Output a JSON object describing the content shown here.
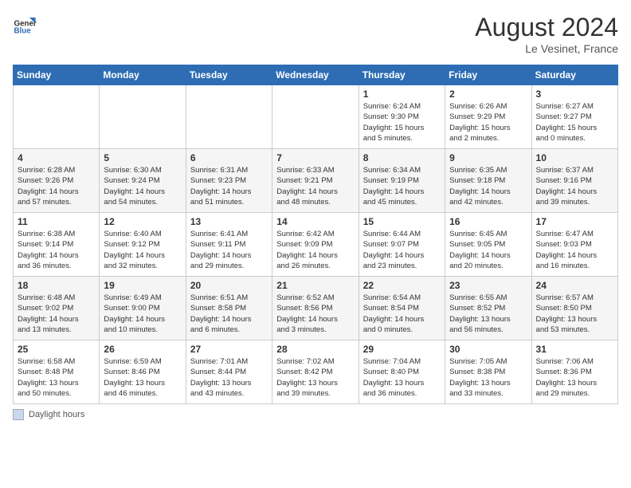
{
  "header": {
    "logo_line1": "General",
    "logo_line2": "Blue",
    "month": "August 2024",
    "location": "Le Vesinet, France"
  },
  "weekdays": [
    "Sunday",
    "Monday",
    "Tuesday",
    "Wednesday",
    "Thursday",
    "Friday",
    "Saturday"
  ],
  "legend": {
    "box_label": "Daylight hours"
  },
  "weeks": [
    [
      {
        "day": "",
        "info": ""
      },
      {
        "day": "",
        "info": ""
      },
      {
        "day": "",
        "info": ""
      },
      {
        "day": "",
        "info": ""
      },
      {
        "day": "1",
        "info": "Sunrise: 6:24 AM\nSunset: 9:30 PM\nDaylight: 15 hours\nand 5 minutes."
      },
      {
        "day": "2",
        "info": "Sunrise: 6:26 AM\nSunset: 9:29 PM\nDaylight: 15 hours\nand 2 minutes."
      },
      {
        "day": "3",
        "info": "Sunrise: 6:27 AM\nSunset: 9:27 PM\nDaylight: 15 hours\nand 0 minutes."
      }
    ],
    [
      {
        "day": "4",
        "info": "Sunrise: 6:28 AM\nSunset: 9:26 PM\nDaylight: 14 hours\nand 57 minutes."
      },
      {
        "day": "5",
        "info": "Sunrise: 6:30 AM\nSunset: 9:24 PM\nDaylight: 14 hours\nand 54 minutes."
      },
      {
        "day": "6",
        "info": "Sunrise: 6:31 AM\nSunset: 9:23 PM\nDaylight: 14 hours\nand 51 minutes."
      },
      {
        "day": "7",
        "info": "Sunrise: 6:33 AM\nSunset: 9:21 PM\nDaylight: 14 hours\nand 48 minutes."
      },
      {
        "day": "8",
        "info": "Sunrise: 6:34 AM\nSunset: 9:19 PM\nDaylight: 14 hours\nand 45 minutes."
      },
      {
        "day": "9",
        "info": "Sunrise: 6:35 AM\nSunset: 9:18 PM\nDaylight: 14 hours\nand 42 minutes."
      },
      {
        "day": "10",
        "info": "Sunrise: 6:37 AM\nSunset: 9:16 PM\nDaylight: 14 hours\nand 39 minutes."
      }
    ],
    [
      {
        "day": "11",
        "info": "Sunrise: 6:38 AM\nSunset: 9:14 PM\nDaylight: 14 hours\nand 36 minutes."
      },
      {
        "day": "12",
        "info": "Sunrise: 6:40 AM\nSunset: 9:12 PM\nDaylight: 14 hours\nand 32 minutes."
      },
      {
        "day": "13",
        "info": "Sunrise: 6:41 AM\nSunset: 9:11 PM\nDaylight: 14 hours\nand 29 minutes."
      },
      {
        "day": "14",
        "info": "Sunrise: 6:42 AM\nSunset: 9:09 PM\nDaylight: 14 hours\nand 26 minutes."
      },
      {
        "day": "15",
        "info": "Sunrise: 6:44 AM\nSunset: 9:07 PM\nDaylight: 14 hours\nand 23 minutes."
      },
      {
        "day": "16",
        "info": "Sunrise: 6:45 AM\nSunset: 9:05 PM\nDaylight: 14 hours\nand 20 minutes."
      },
      {
        "day": "17",
        "info": "Sunrise: 6:47 AM\nSunset: 9:03 PM\nDaylight: 14 hours\nand 16 minutes."
      }
    ],
    [
      {
        "day": "18",
        "info": "Sunrise: 6:48 AM\nSunset: 9:02 PM\nDaylight: 14 hours\nand 13 minutes."
      },
      {
        "day": "19",
        "info": "Sunrise: 6:49 AM\nSunset: 9:00 PM\nDaylight: 14 hours\nand 10 minutes."
      },
      {
        "day": "20",
        "info": "Sunrise: 6:51 AM\nSunset: 8:58 PM\nDaylight: 14 hours\nand 6 minutes."
      },
      {
        "day": "21",
        "info": "Sunrise: 6:52 AM\nSunset: 8:56 PM\nDaylight: 14 hours\nand 3 minutes."
      },
      {
        "day": "22",
        "info": "Sunrise: 6:54 AM\nSunset: 8:54 PM\nDaylight: 14 hours\nand 0 minutes."
      },
      {
        "day": "23",
        "info": "Sunrise: 6:55 AM\nSunset: 8:52 PM\nDaylight: 13 hours\nand 56 minutes."
      },
      {
        "day": "24",
        "info": "Sunrise: 6:57 AM\nSunset: 8:50 PM\nDaylight: 13 hours\nand 53 minutes."
      }
    ],
    [
      {
        "day": "25",
        "info": "Sunrise: 6:58 AM\nSunset: 8:48 PM\nDaylight: 13 hours\nand 50 minutes."
      },
      {
        "day": "26",
        "info": "Sunrise: 6:59 AM\nSunset: 8:46 PM\nDaylight: 13 hours\nand 46 minutes."
      },
      {
        "day": "27",
        "info": "Sunrise: 7:01 AM\nSunset: 8:44 PM\nDaylight: 13 hours\nand 43 minutes."
      },
      {
        "day": "28",
        "info": "Sunrise: 7:02 AM\nSunset: 8:42 PM\nDaylight: 13 hours\nand 39 minutes."
      },
      {
        "day": "29",
        "info": "Sunrise: 7:04 AM\nSunset: 8:40 PM\nDaylight: 13 hours\nand 36 minutes."
      },
      {
        "day": "30",
        "info": "Sunrise: 7:05 AM\nSunset: 8:38 PM\nDaylight: 13 hours\nand 33 minutes."
      },
      {
        "day": "31",
        "info": "Sunrise: 7:06 AM\nSunset: 8:36 PM\nDaylight: 13 hours\nand 29 minutes."
      }
    ]
  ]
}
